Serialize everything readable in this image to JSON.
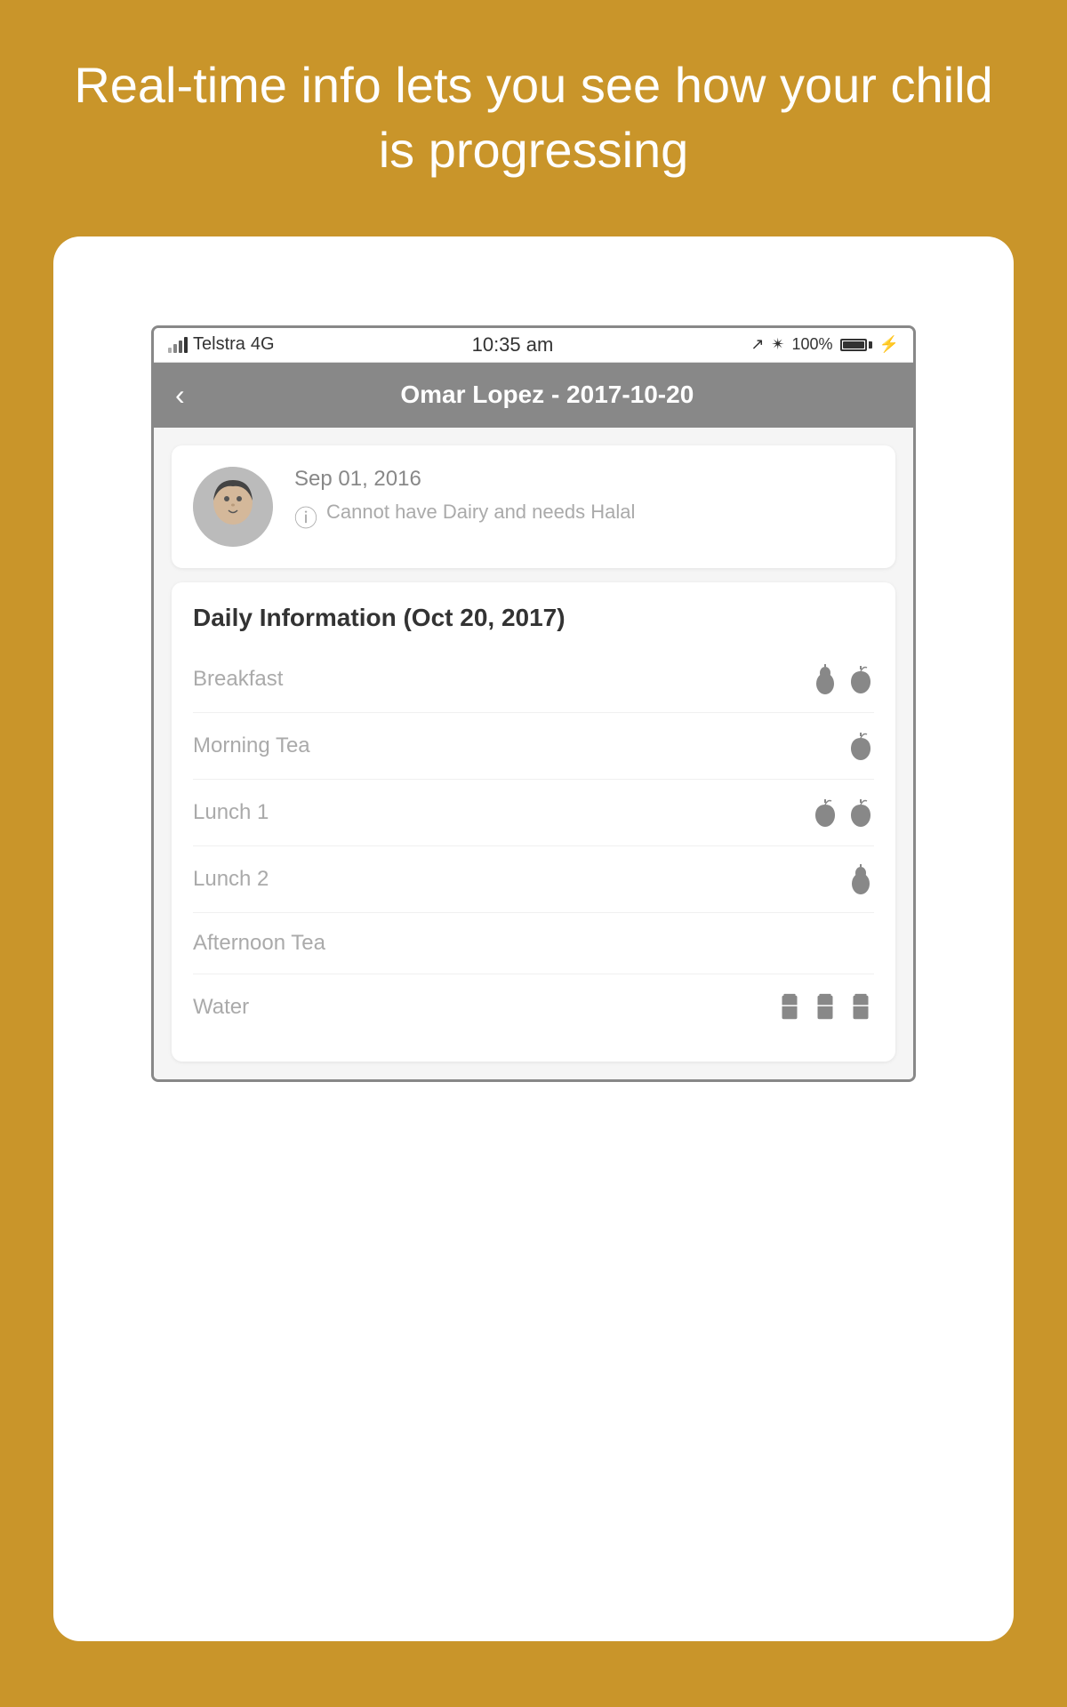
{
  "page": {
    "background_color": "#C9952A",
    "header_text": "Real-time info lets you see how your child is progressing"
  },
  "status_bar": {
    "carrier": "Telstra",
    "network": "4G",
    "time": "10:35 am",
    "battery": "100%"
  },
  "nav": {
    "title": "Omar Lopez - 2017-10-20",
    "back_label": "‹"
  },
  "profile": {
    "date": "Sep 01, 2016",
    "note": "Cannot have Dairy and needs Halal"
  },
  "daily": {
    "title": "Daily Information (Oct 20, 2017)",
    "meals": [
      {
        "label": "Breakfast",
        "icons": [
          "pear",
          "apple"
        ]
      },
      {
        "label": "Morning Tea",
        "icons": [
          "apple"
        ]
      },
      {
        "label": "Lunch 1",
        "icons": [
          "apple",
          "apple"
        ]
      },
      {
        "label": "Lunch 2",
        "icons": [
          "pear"
        ]
      },
      {
        "label": "Afternoon Tea",
        "icons": []
      },
      {
        "label": "Water",
        "icons": [
          "water",
          "water",
          "water"
        ]
      }
    ]
  }
}
